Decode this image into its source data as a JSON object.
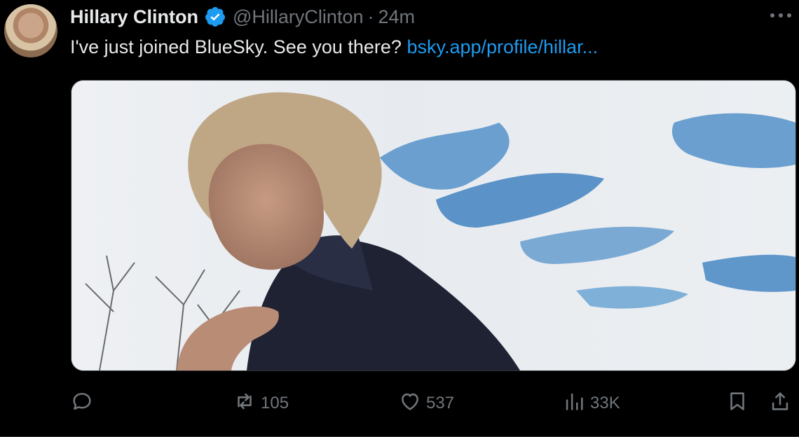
{
  "author": {
    "name": "Hillary Clinton",
    "handle": "@HillaryClinton",
    "separator": "·",
    "time": "24m",
    "verified_icon": "verified-badge-icon",
    "avatar_icon": "avatar"
  },
  "tweet": {
    "text": "I've just joined BlueSky. See you there? ",
    "link_text": "bsky.app/profile/hillar..."
  },
  "actions": {
    "reply": {
      "icon": "reply-icon",
      "count": ""
    },
    "retweet": {
      "icon": "retweet-icon",
      "count": "105"
    },
    "like": {
      "icon": "heart-icon",
      "count": "537"
    },
    "views": {
      "icon": "views-icon",
      "count": "33K"
    },
    "bookmark": {
      "icon": "bookmark-icon"
    },
    "share": {
      "icon": "share-icon"
    }
  },
  "colors": {
    "background": "#000000",
    "text": "#e7e9ea",
    "muted": "#71767b",
    "link": "#1d9bf0",
    "verified": "#1d9bf0"
  }
}
